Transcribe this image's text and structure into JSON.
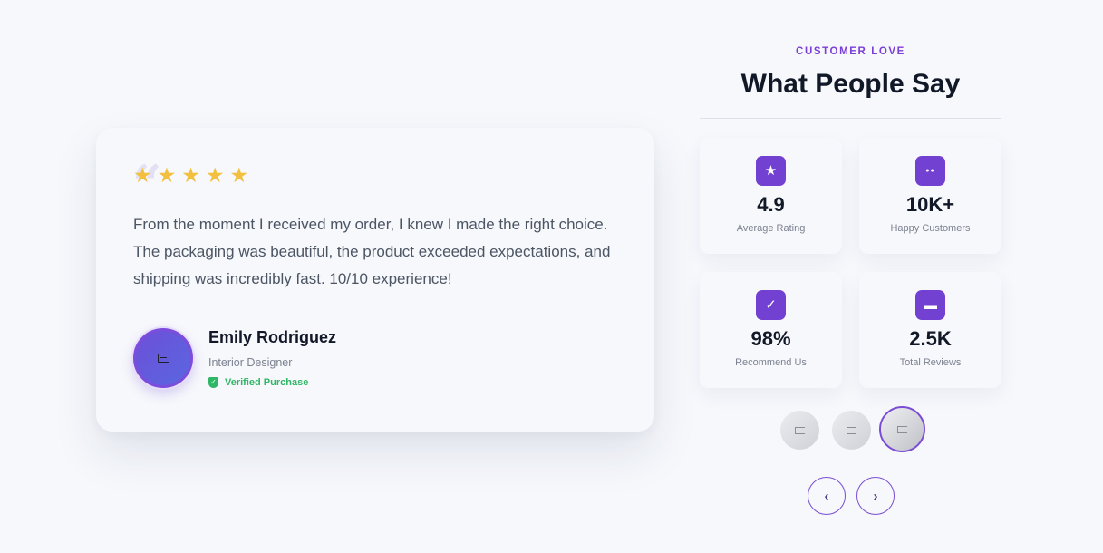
{
  "testimonial": {
    "quote_mark": "“",
    "stars": [
      "★",
      "★",
      "★",
      "★",
      "★"
    ],
    "text": "From the moment I received my order, I knew I made the right choice. The packaging was beautiful, the product exceeded expectations, and shipping was incredibly fast. 10/10 experience!",
    "author": {
      "name": "Emily Rodriguez",
      "role": "Interior Designer",
      "verified_label": "Verified Purchase"
    }
  },
  "section": {
    "eyebrow": "CUSTOMER LOVE",
    "headline": "What People Say"
  },
  "stats": [
    {
      "icon": "star-icon",
      "glyph": "★",
      "value": "4.9",
      "label": "Average Rating"
    },
    {
      "icon": "users-icon",
      "glyph": "●●",
      "value": "10K+",
      "label": "Happy Customers"
    },
    {
      "icon": "check-icon",
      "glyph": "✓",
      "value": "98%",
      "label": "Recommend Us"
    },
    {
      "icon": "chat-bubble-icon",
      "glyph": "▬",
      "value": "2.5K",
      "label": "Total Reviews"
    }
  ],
  "navigation": {
    "prev_glyph": "‹",
    "next_glyph": "›"
  },
  "colors": {
    "accent": "#7341d2",
    "star": "#f2bf3f",
    "verified": "#2fb765",
    "background": "#f6f8fc"
  }
}
